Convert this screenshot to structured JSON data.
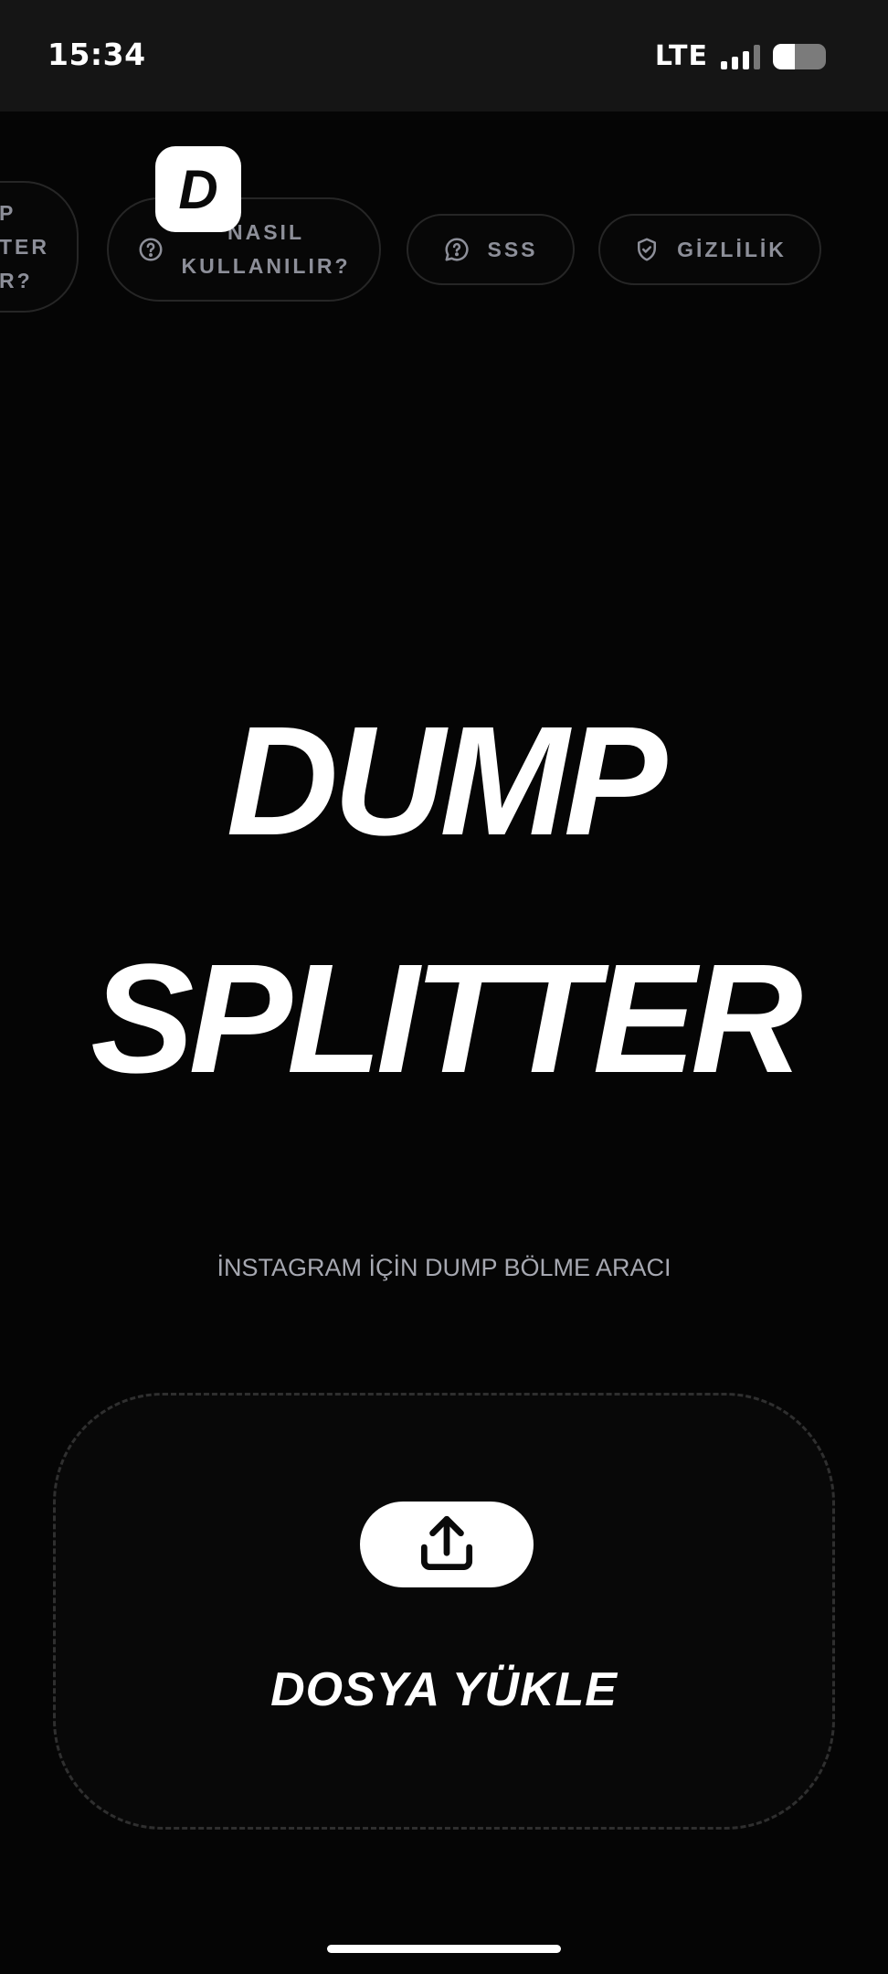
{
  "status_bar": {
    "time": "15:34",
    "network": "LTE"
  },
  "nav": {
    "partial_chip_lines": [
      "P",
      "TER",
      "R?"
    ],
    "how_to_line1": "NASIL",
    "how_to_line2": "KULLANILIR?",
    "faq_label": "SSS",
    "privacy_label": "GİZLİLİK"
  },
  "logo": {
    "letter": "D"
  },
  "hero": {
    "line1": "DUMP",
    "line2": "SPLITTER",
    "subtitle": "İNSTAGRAM İÇİN DUMP BÖLME ARACI"
  },
  "upload": {
    "label": "DOSYA YÜKLE"
  },
  "colors": {
    "background": "#050505",
    "status_bar": "#151515",
    "chip_text": "#8d8f99",
    "chip_border": "#262626",
    "subtitle": "#a6a8b1",
    "accent": "#ffffff"
  }
}
